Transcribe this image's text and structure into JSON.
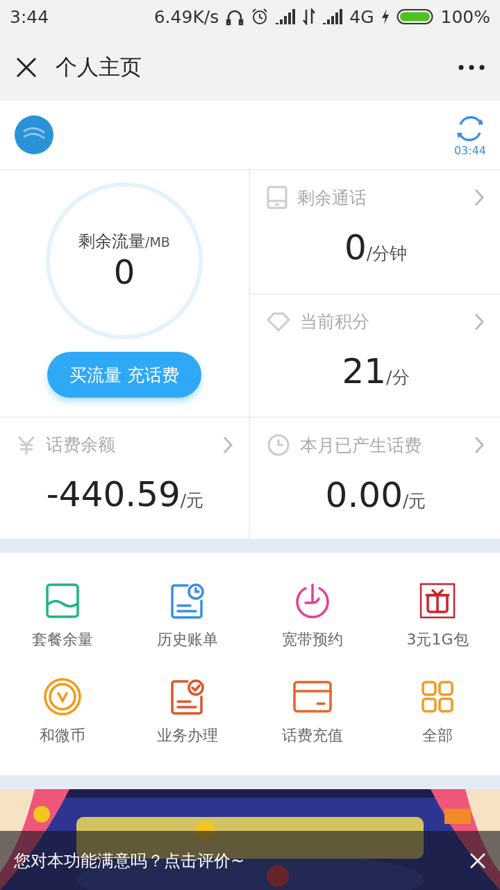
{
  "status_bar": {
    "time": "3:44",
    "speed": "6.49K/s",
    "network": "4G",
    "battery": "100%"
  },
  "header": {
    "title": "个人主页"
  },
  "profile": {
    "refresh_time": "03:44"
  },
  "data_card": {
    "label": "剩余流量",
    "unit": "/MB",
    "value": "0",
    "button": "买流量 充话费"
  },
  "stats": [
    {
      "kind": "phone",
      "label": "剩余通话",
      "value": "0",
      "unit": "/分钟"
    },
    {
      "kind": "diamond",
      "label": "当前积分",
      "value": "21",
      "unit": "/分"
    },
    {
      "kind": "yuan",
      "label": "话费余额",
      "value": "-440.59",
      "unit": "/元"
    },
    {
      "kind": "clock",
      "label": "本月已产生话费",
      "value": "0.00",
      "unit": "/元"
    }
  ],
  "shortcuts": [
    {
      "kind": "wave",
      "label": "套餐余量"
    },
    {
      "kind": "bill",
      "label": "历史账单"
    },
    {
      "kind": "power",
      "label": "宽带预约"
    },
    {
      "kind": "gift",
      "label": "3元1G包"
    },
    {
      "kind": "coin",
      "label": "和微币"
    },
    {
      "kind": "task",
      "label": "业务办理"
    },
    {
      "kind": "card",
      "label": "话费充值"
    },
    {
      "kind": "grid",
      "label": "全部"
    }
  ],
  "feedback": {
    "text": "您对本功能满意吗？点击评价~"
  }
}
